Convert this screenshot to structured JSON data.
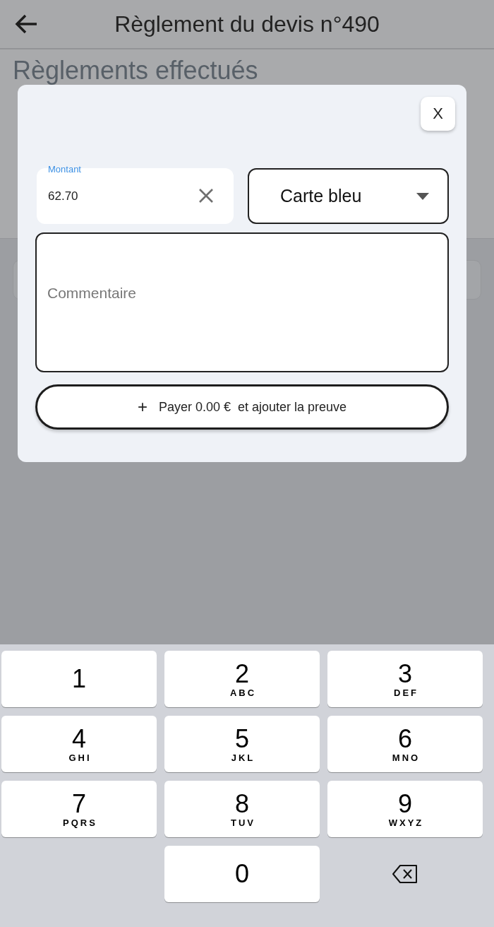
{
  "app_bar": {
    "title": "Règlement du devis n°490"
  },
  "background": {
    "heading": "Règlements effectués"
  },
  "dialog": {
    "close_label": "X",
    "amount": {
      "label": "Montant",
      "value": "62.70"
    },
    "payment_method": {
      "value": "Carte bleu"
    },
    "comment": {
      "placeholder": "Commentaire"
    },
    "submit": {
      "icon": "+",
      "label": "Payer 0.00 €  et ajouter la preuve"
    }
  },
  "keyboard": {
    "keys": [
      {
        "kind": "digit",
        "digit": "1"
      },
      {
        "kind": "digit",
        "digit": "2",
        "letters": "ABC"
      },
      {
        "kind": "digit",
        "digit": "3",
        "letters": "DEF"
      },
      {
        "kind": "digit",
        "digit": "4",
        "letters": "GHI"
      },
      {
        "kind": "digit",
        "digit": "5",
        "letters": "JKL"
      },
      {
        "kind": "digit",
        "digit": "6",
        "letters": "MNO"
      },
      {
        "kind": "digit",
        "digit": "7",
        "letters": "PQRS"
      },
      {
        "kind": "digit",
        "digit": "8",
        "letters": "TUV"
      },
      {
        "kind": "digit",
        "digit": "9",
        "letters": "WXYZ"
      },
      {
        "kind": "blank"
      },
      {
        "kind": "digit",
        "digit": "0"
      },
      {
        "kind": "backspace"
      }
    ]
  }
}
